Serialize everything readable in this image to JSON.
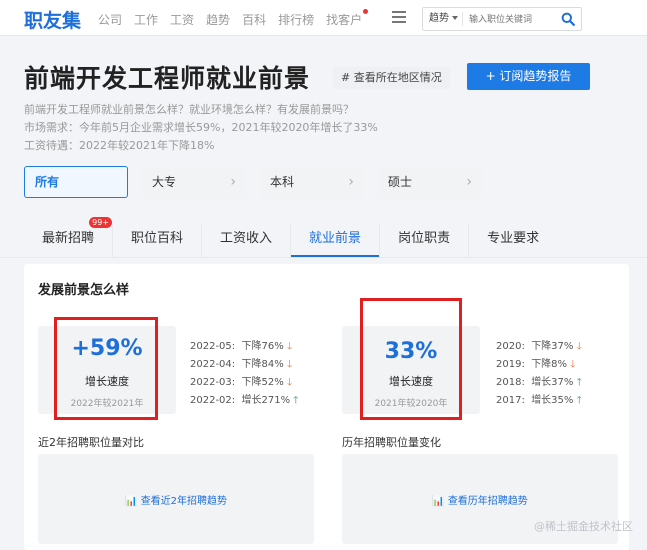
{
  "header": {
    "logo": "职友集",
    "nav": [
      "公司",
      "工作",
      "工资",
      "趋势",
      "百科",
      "排行榜",
      "找客户"
    ],
    "search": {
      "scope": "趋势",
      "placeholder": "输入职位关键词"
    }
  },
  "page": {
    "title": "前端开发工程师就业前景",
    "location_button": "# 查看所在地区情况",
    "subscribe_button": "+ 订阅趋势报告",
    "desc": [
      "前端开发工程师就业前景怎么样？就业环境怎么样？有发展前景吗？",
      "市场需求：今年前5月企业需求增长59%，2021年较2020年增长了33%",
      "工资待遇：2022年较2021年下降18%"
    ]
  },
  "filters": [
    "所有",
    "大专",
    "本科",
    "硕士"
  ],
  "tabs": {
    "items": [
      "最新招聘",
      "职位百科",
      "工资收入",
      "就业前景",
      "岗位职责",
      "专业要求"
    ],
    "badge": "99+"
  },
  "prospects": {
    "title": "发展前景怎么样",
    "left": {
      "value": "+59%",
      "label": "增长速度",
      "compare": "2022年较2021年",
      "history": [
        {
          "period": "2022-05:",
          "text": "下降76%",
          "dir": "down"
        },
        {
          "period": "2022-04:",
          "text": "下降84%",
          "dir": "down"
        },
        {
          "period": "2022-03:",
          "text": "下降52%",
          "dir": "down"
        },
        {
          "period": "2022-02:",
          "text": "增长271%",
          "dir": "up"
        }
      ],
      "section_title": "近2年招聘职位量对比",
      "link": "查看近2年招聘趋势"
    },
    "right": {
      "value": "33%",
      "label": "增长速度",
      "compare": "2021年较2020年",
      "history": [
        {
          "period": "2020:",
          "text": "下降37%",
          "dir": "down"
        },
        {
          "period": "2019:",
          "text": "下降8%",
          "dir": "down"
        },
        {
          "period": "2018:",
          "text": "增长37%",
          "dir": "up"
        },
        {
          "period": "2017:",
          "text": "增长35%",
          "dir": "up"
        }
      ],
      "section_title": "历年招聘职位量变化",
      "link": "查看历年招聘趋势"
    }
  },
  "watermark": "@稀土掘金技术社区",
  "colors": {
    "brand": "#1e6fd9",
    "button": "#1e7be6",
    "alert": "#e02020",
    "down": "#f07030",
    "up": "#2aa046"
  }
}
